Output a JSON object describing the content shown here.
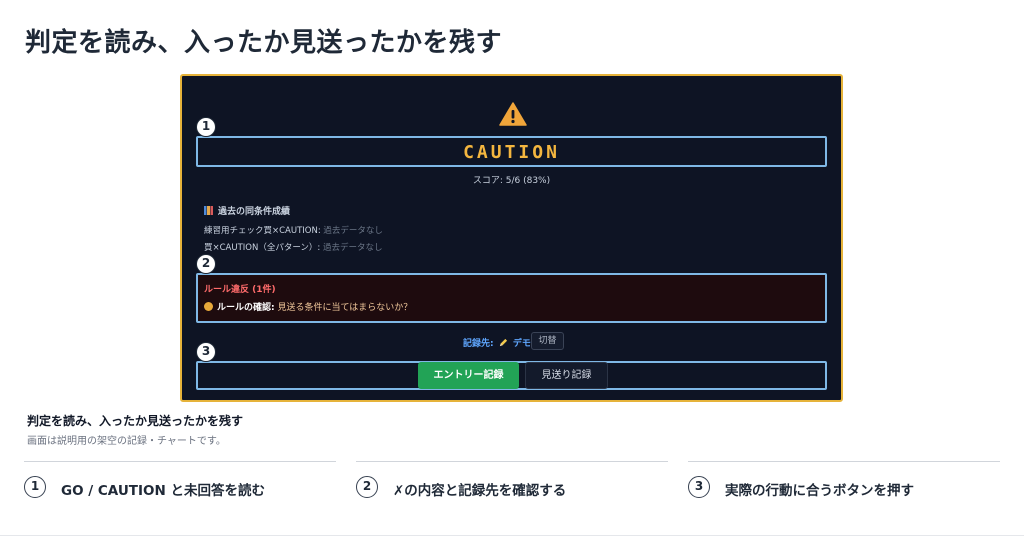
{
  "page_title": "判定を読み、入ったか見送ったかを残す",
  "screen": {
    "caution_label": "CAUTION",
    "score": "スコア: 5/6 (83%)",
    "stats_title": "過去の同条件成績",
    "stats": [
      {
        "label": "練習用チェック買×CAUTION:",
        "value": "過去データなし"
      },
      {
        "label": "買×CAUTION（全パターン）:",
        "value": "過去データなし"
      }
    ],
    "violation": {
      "title": "ルール違反 (1件)",
      "item_bold": "ルールの確認:",
      "item_text": "見送る条件に当てはまらないか？"
    },
    "record_dest_label": "記録先:",
    "record_dest_value": "デモ",
    "switch_label": "切替",
    "entry_button": "エントリー記録",
    "skip_button": "見送り記録"
  },
  "badges": [
    "1",
    "2",
    "3"
  ],
  "caption": {
    "title": "判定を読み、入ったか見送ったかを残す",
    "subtitle": "画面は説明用の架空の記録・チャートです。"
  },
  "steps": [
    {
      "num": "1",
      "label": "GO / CAUTION と未回答を読む"
    },
    {
      "num": "2",
      "label": "✗の内容と記録先を確認する"
    },
    {
      "num": "3",
      "label": "実際の行動に合うボタンを押す"
    }
  ],
  "colors": {
    "screen_bg": "#0e1424",
    "screen_border": "#e6b33a",
    "caution": "#f4b63f",
    "callout": "#7fb8e6",
    "violation": "#ff6b6b",
    "entry_button": "#22a356",
    "record_dest": "#5fa7ff"
  },
  "icons": [
    "warning-triangle-icon",
    "chart-icon",
    "warning-dot-icon",
    "pencil-icon"
  ]
}
